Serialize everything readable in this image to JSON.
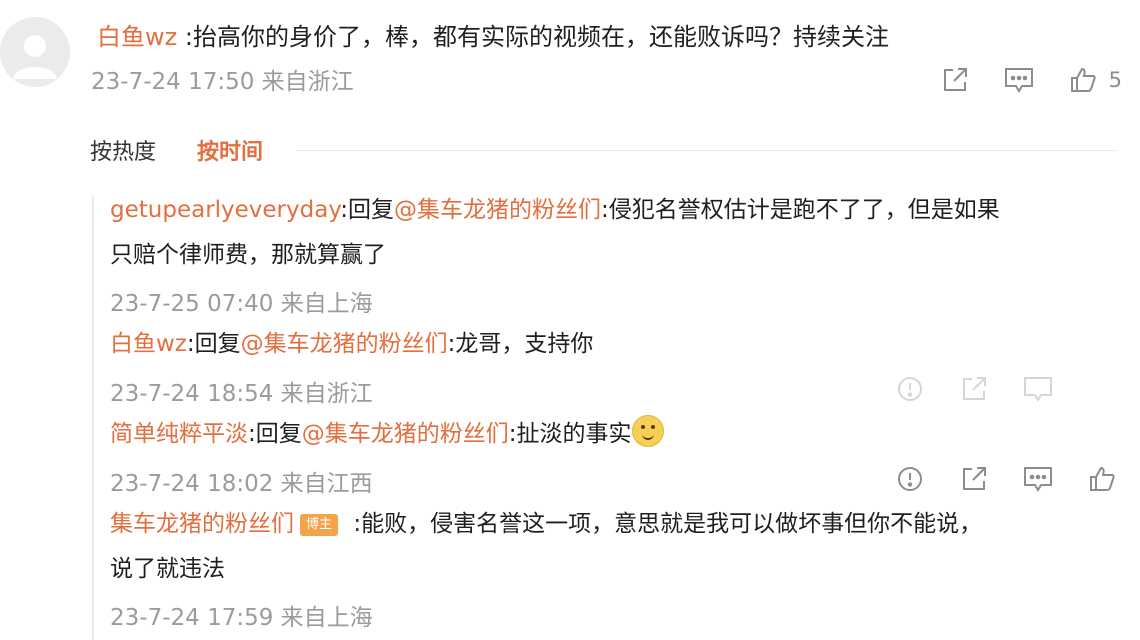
{
  "top_comment": {
    "username": "白鱼wz",
    "text": " :抬高你的身价了，棒，都有实际的视频在，还能败诉吗？持续关注",
    "meta": "23-7-24 17:50 来自浙江",
    "like_count": "5"
  },
  "sort_tabs": {
    "hot": "按热度",
    "time": "按时间"
  },
  "replies": [
    {
      "username": "getupearlyeveryday",
      "reply_prefix": ":回复",
      "mention": "@集车龙猪的粉丝们",
      "text_line1": ":侵犯名誉权估计是跑不了了，但是如果",
      "text_line2": "只赔个律师费，那就算赢了",
      "meta": "23-7-25 07:40 来自上海"
    },
    {
      "username": "白鱼wz",
      "reply_prefix": ":回复",
      "mention": "@集车龙猪的粉丝们",
      "text": ":龙哥，支持你",
      "meta": "23-7-24 18:54 来自浙江"
    },
    {
      "username": "简单纯粹平淡",
      "reply_prefix": ":回复",
      "mention": "@集车龙猪的粉丝们",
      "text": ":扯淡的事实",
      "emoji": "grin-emoji",
      "meta": "23-7-24 18:02 来自江西"
    },
    {
      "username": "集车龙猪的粉丝们",
      "badge": "博主",
      "text_line1": " :能败，侵害名誉这一项，意思就是我可以做坏事但你不能说，",
      "text_line2": "说了就违法",
      "meta": "23-7-24 17:59 来自上海"
    }
  ],
  "colors": {
    "accent": "#e36f3f",
    "meta": "#9b9b9b",
    "badge": "#f5a34a"
  },
  "icons": [
    "share-icon",
    "comment-icon",
    "like-icon",
    "report-icon"
  ]
}
